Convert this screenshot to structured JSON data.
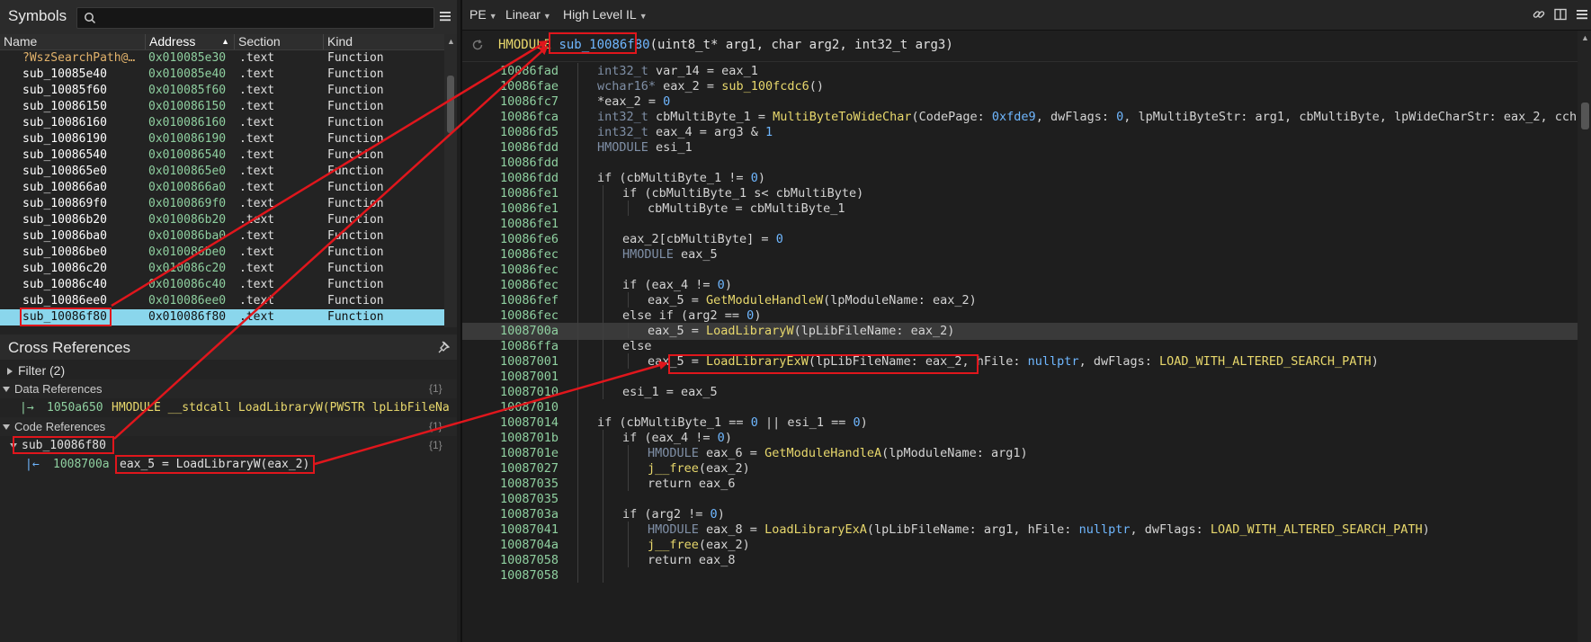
{
  "symbols": {
    "title": "Symbols",
    "search_placeholder": "",
    "columns": [
      "Name",
      "Address",
      "Section",
      "Kind"
    ],
    "sorted_column": "Address",
    "rows": [
      {
        "name": "?WszSearchPath@…",
        "address": "0x010085e30",
        "section": ".text",
        "kind": "Function"
      },
      {
        "name": "sub_10085e40",
        "address": "0x010085e40",
        "section": ".text",
        "kind": "Function"
      },
      {
        "name": "sub_10085f60",
        "address": "0x010085f60",
        "section": ".text",
        "kind": "Function"
      },
      {
        "name": "sub_10086150",
        "address": "0x010086150",
        "section": ".text",
        "kind": "Function"
      },
      {
        "name": "sub_10086160",
        "address": "0x010086160",
        "section": ".text",
        "kind": "Function"
      },
      {
        "name": "sub_10086190",
        "address": "0x010086190",
        "section": ".text",
        "kind": "Function"
      },
      {
        "name": "sub_10086540",
        "address": "0x010086540",
        "section": ".text",
        "kind": "Function"
      },
      {
        "name": "sub_100865e0",
        "address": "0x0100865e0",
        "section": ".text",
        "kind": "Function"
      },
      {
        "name": "sub_100866a0",
        "address": "0x0100866a0",
        "section": ".text",
        "kind": "Function"
      },
      {
        "name": "sub_100869f0",
        "address": "0x0100869f0",
        "section": ".text",
        "kind": "Function"
      },
      {
        "name": "sub_10086b20",
        "address": "0x010086b20",
        "section": ".text",
        "kind": "Function"
      },
      {
        "name": "sub_10086ba0",
        "address": "0x010086ba0",
        "section": ".text",
        "kind": "Function"
      },
      {
        "name": "sub_10086be0",
        "address": "0x010086be0",
        "section": ".text",
        "kind": "Function"
      },
      {
        "name": "sub_10086c20",
        "address": "0x010086c20",
        "section": ".text",
        "kind": "Function"
      },
      {
        "name": "sub_10086c40",
        "address": "0x010086c40",
        "section": ".text",
        "kind": "Function"
      },
      {
        "name": "sub_10086ee0",
        "address": "0x010086ee0",
        "section": ".text",
        "kind": "Function"
      },
      {
        "name": "sub_10086f80",
        "address": "0x010086f80",
        "section": ".text",
        "kind": "Function"
      }
    ]
  },
  "cross_references": {
    "title": "Cross References",
    "filter_label": "Filter (2)",
    "data_refs_label": "Data References",
    "data_refs_count": "{1}",
    "data_ref_address": "1050a650",
    "data_ref_text": "HMODULE __stdcall LoadLibraryW(PWSTR lpLibFileNa",
    "code_refs_label": "Code References",
    "code_refs_count": "{1}",
    "code_ref_func": "sub_10086f80",
    "code_ref_func_count": "{1}",
    "code_ref_address": "1008700a",
    "code_ref_text": "eax_5 = LoadLibraryW(eax_2)"
  },
  "toolbar": {
    "platform": "PE",
    "view": "Linear",
    "il": "High Level IL"
  },
  "function_header": {
    "return_type": "HMODULE",
    "name": "sub_10086f80",
    "params": "(uint8_t* arg1, char arg2, int32_t arg3)"
  },
  "colors": {
    "highlight_box": "#e0161c",
    "selection": "#8ad6ec",
    "address_green": "#8fd0a0",
    "func_yellow": "#e8d86c",
    "number_blue": "#6fb7ff"
  },
  "code_lines": [
    {
      "addr": "10086fad",
      "indent": 1,
      "code": "int32_t var_14 = eax_1"
    },
    {
      "addr": "10086fae",
      "indent": 1,
      "code": "wchar16* eax_2 = sub_100fcdc6()"
    },
    {
      "addr": "10086fc7",
      "indent": 1,
      "code": "*eax_2 = 0"
    },
    {
      "addr": "10086fca",
      "indent": 1,
      "code": "int32_t cbMultiByte_1 = MultiByteToWideChar(CodePage: 0xfde9, dwFlags: 0, lpMultiByteStr: arg1, cbMultiByte, lpWideCharStr: eax_2, cch"
    },
    {
      "addr": "10086fd5",
      "indent": 1,
      "code": "int32_t eax_4 = arg3 & 1"
    },
    {
      "addr": "10086fdd",
      "indent": 1,
      "code": "HMODULE esi_1"
    },
    {
      "addr": "10086fdd",
      "indent": 1,
      "code": ""
    },
    {
      "addr": "10086fdd",
      "indent": 1,
      "code": "if (cbMultiByte_1 != 0)"
    },
    {
      "addr": "10086fe1",
      "indent": 2,
      "code": "if (cbMultiByte_1 s< cbMultiByte)"
    },
    {
      "addr": "10086fe1",
      "indent": 3,
      "code": "cbMultiByte = cbMultiByte_1"
    },
    {
      "addr": "10086fe1",
      "indent": 2,
      "code": ""
    },
    {
      "addr": "10086fe6",
      "indent": 2,
      "code": "eax_2[cbMultiByte] = 0"
    },
    {
      "addr": "10086fec",
      "indent": 2,
      "code": "HMODULE eax_5"
    },
    {
      "addr": "10086fec",
      "indent": 2,
      "code": ""
    },
    {
      "addr": "10086fec",
      "indent": 2,
      "code": "if (eax_4 != 0)"
    },
    {
      "addr": "10086fef",
      "indent": 3,
      "code": "eax_5 = GetModuleHandleW(lpModuleName: eax_2)"
    },
    {
      "addr": "10086fec",
      "indent": 2,
      "code": "else if (arg2 == 0)"
    },
    {
      "addr": "1008700a",
      "indent": 3,
      "code": "eax_5 = LoadLibraryW(lpLibFileName: eax_2)"
    },
    {
      "addr": "10086ffa",
      "indent": 2,
      "code": "else"
    },
    {
      "addr": "10087001",
      "indent": 3,
      "code": "eax_5 = LoadLibraryExW(lpLibFileName: eax_2, hFile: nullptr, dwFlags: LOAD_WITH_ALTERED_SEARCH_PATH)"
    },
    {
      "addr": "10087001",
      "indent": 2,
      "code": ""
    },
    {
      "addr": "10087010",
      "indent": 2,
      "code": "esi_1 = eax_5"
    },
    {
      "addr": "10087010",
      "indent": 1,
      "code": ""
    },
    {
      "addr": "10087014",
      "indent": 1,
      "code": "if (cbMultiByte_1 == 0 || esi_1 == 0)"
    },
    {
      "addr": "1008701b",
      "indent": 2,
      "code": "if (eax_4 != 0)"
    },
    {
      "addr": "1008701e",
      "indent": 3,
      "code": "HMODULE eax_6 = GetModuleHandleA(lpModuleName: arg1)"
    },
    {
      "addr": "10087027",
      "indent": 3,
      "code": "j__free(eax_2)"
    },
    {
      "addr": "10087035",
      "indent": 3,
      "code": "return eax_6"
    },
    {
      "addr": "10087035",
      "indent": 2,
      "code": ""
    },
    {
      "addr": "1008703a",
      "indent": 2,
      "code": "if (arg2 != 0)"
    },
    {
      "addr": "10087041",
      "indent": 3,
      "code": "HMODULE eax_8 = LoadLibraryExA(lpLibFileName: arg1, hFile: nullptr, dwFlags: LOAD_WITH_ALTERED_SEARCH_PATH)"
    },
    {
      "addr": "1008704a",
      "indent": 3,
      "code": "j__free(eax_2)"
    },
    {
      "addr": "10087058",
      "indent": 3,
      "code": "return eax_8"
    },
    {
      "addr": "10087058",
      "indent": 2,
      "code": ""
    }
  ]
}
